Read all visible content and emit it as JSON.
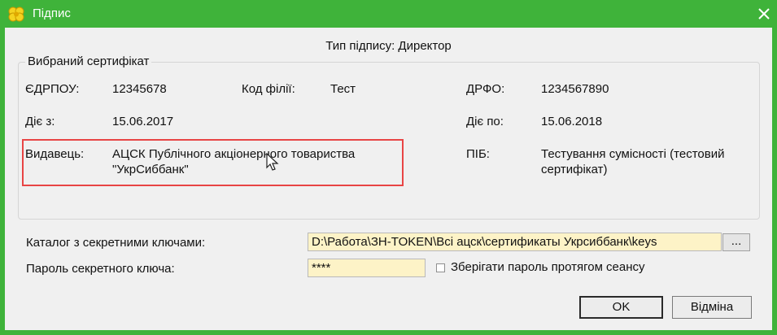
{
  "window": {
    "title": "Підпис",
    "close_glyph": "✕"
  },
  "signature_type": "Тип підпису: Директор",
  "certificate": {
    "legend": "Вибраний сертифікат",
    "edrpou_label": "ЄДРПОУ:",
    "edrpou_value": "12345678",
    "branch_label": "Код філії:",
    "branch_value": "Тест",
    "drfo_label": "ДРФО:",
    "drfo_value": "1234567890",
    "valid_from_label": "Діє з:",
    "valid_from_value": "15.06.2017",
    "valid_to_label": "Діє по:",
    "valid_to_value": "15.06.2018",
    "issuer_label": "Видавець:",
    "issuer_line1": "АЦСК Публічного акціонерного товариства",
    "issuer_line2": "\"УкрСиббанк\"",
    "name_label": "ПІБ:",
    "name_line1": "Тестування сумісності (тестовий",
    "name_line2": "сертифікат)"
  },
  "keys": {
    "catalog_label": "Каталог з секретними ключами:",
    "catalog_value": "D:\\Работа\\ЗН-TOKEN\\Всі ацск\\сертификаты Укрсиббанк\\keys",
    "browse_label": "...",
    "password_label": "Пароль секретного ключа:",
    "password_value": "****",
    "remember_label": "Зберігати пароль протягом сеансу",
    "remember_checked": false
  },
  "buttons": {
    "ok": "OK",
    "cancel": "Відміна"
  },
  "colors": {
    "titlebar": "#3fb33a",
    "highlight": "#e84545",
    "input_bg": "#fdf3c7"
  },
  "icons": {
    "app": "yellow-flower-icon",
    "close": "close-icon",
    "cursor": "mouse-pointer-icon"
  }
}
